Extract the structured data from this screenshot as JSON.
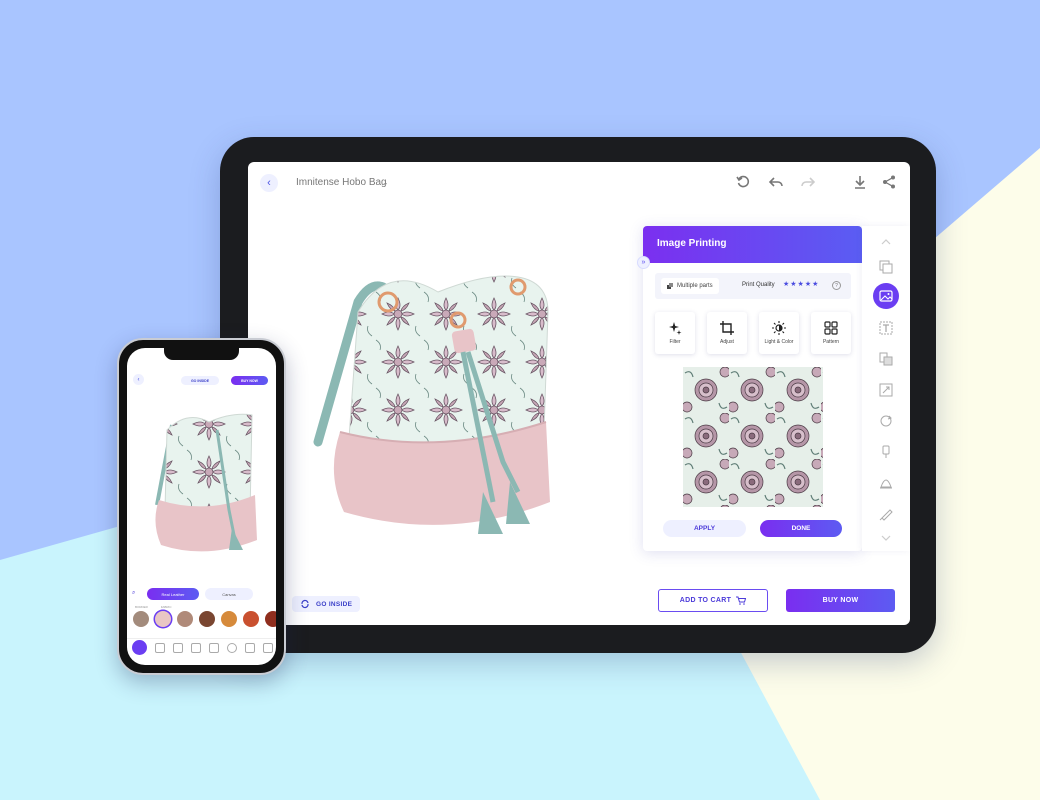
{
  "colors": {
    "bg_blue": "#a9c5ff",
    "bg_cream": "#fdfdea",
    "bg_cyan": "#c9f4fd",
    "accent_purple": "#6b3ef2",
    "gradient_start": "#7a2ef0",
    "gradient_end": "#5d5bf2",
    "bag_mint": "#e8f3ee",
    "bag_pink": "#e8c4c8",
    "strap_teal": "#8bb8b3",
    "flower_mauve": "#9a7f8f"
  },
  "tablet": {
    "header": {
      "back_icon": "chevron-left-icon",
      "product_title": "Imnitense Hobo Bag",
      "title_caret_icon": "chevron-down-icon",
      "icons": [
        "reset-icon",
        "undo-icon",
        "redo-icon",
        "download-icon",
        "share-icon"
      ]
    },
    "go_inside_label": "GO INSIDE",
    "add_to_cart_label": "ADD TO CART",
    "buy_now_label": "BUY NOW",
    "panel": {
      "title": "Image Printing",
      "multiple_parts_label": "Multiple parts",
      "print_quality_label": "Print Quality",
      "stars": "★★★★★",
      "tools": [
        {
          "label": "Filter",
          "icon": "sparkle-icon"
        },
        {
          "label": "Adjust",
          "icon": "crop-icon"
        },
        {
          "label": "Light & Color",
          "icon": "brightness-icon"
        },
        {
          "label": "Pattern",
          "icon": "grid-icon"
        }
      ],
      "apply_label": "APPLY",
      "done_label": "DONE"
    },
    "sidebar_icons": [
      "chevron-up-icon",
      "copy-layers-icon",
      "image-icon",
      "text-icon",
      "stickers-icon",
      "resize-icon",
      "rotate-icon",
      "zipper-icon",
      "shape-icon",
      "pen-icon",
      "chevron-down-icon"
    ]
  },
  "phone": {
    "go_inside_label": "GO INSIDE",
    "buy_now_label": "BUY NOW",
    "tabs": [
      "Real Leather",
      "Canvas"
    ],
    "swatch_labels": [
      "BORDER",
      "FABRIC"
    ],
    "swatches": [
      "#a38b7c",
      "#e9c6c4",
      "#b08a79",
      "#7a4631",
      "#d68a3b",
      "#c9502f",
      "#8f2e1e"
    ]
  }
}
